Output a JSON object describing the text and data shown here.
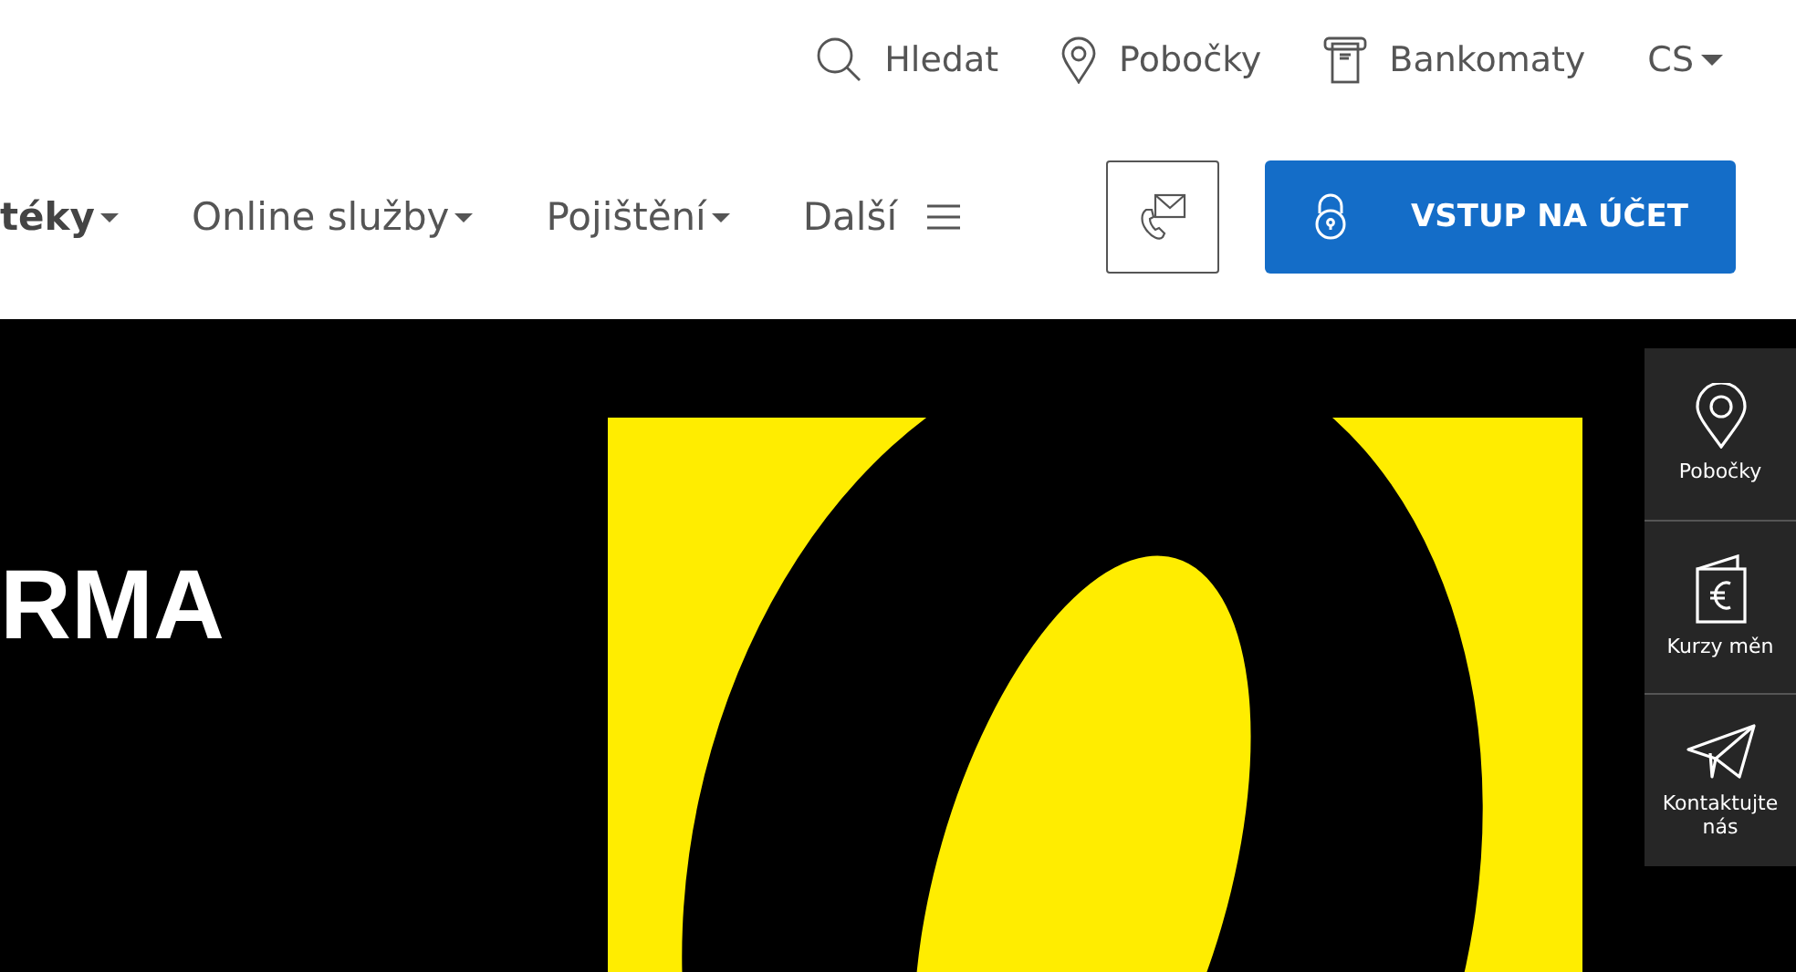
{
  "top_links": [
    {
      "kind": "search",
      "label": "Hledat"
    },
    {
      "kind": "pin",
      "label": "Pobočky"
    },
    {
      "kind": "atm",
      "label": "Bankomaty"
    }
  ],
  "language": {
    "label": "CS"
  },
  "nav": [
    {
      "label": "téky",
      "selected": true,
      "kind": "dropdown"
    },
    {
      "label": "Online služby",
      "selected": false,
      "kind": "dropdown"
    },
    {
      "label": "Pojištění",
      "selected": false,
      "kind": "dropdown"
    },
    {
      "label": "Další",
      "selected": false,
      "kind": "menu"
    }
  ],
  "login_button": {
    "label": "VSTUP NA ÚČET"
  },
  "hero": {
    "heading": "RMA"
  },
  "side_panel": [
    {
      "kind": "pin",
      "label": "Pobočky"
    },
    {
      "kind": "euro",
      "label": "Kurzy měn"
    },
    {
      "kind": "plane",
      "label": "Kontaktujte nás"
    }
  ]
}
